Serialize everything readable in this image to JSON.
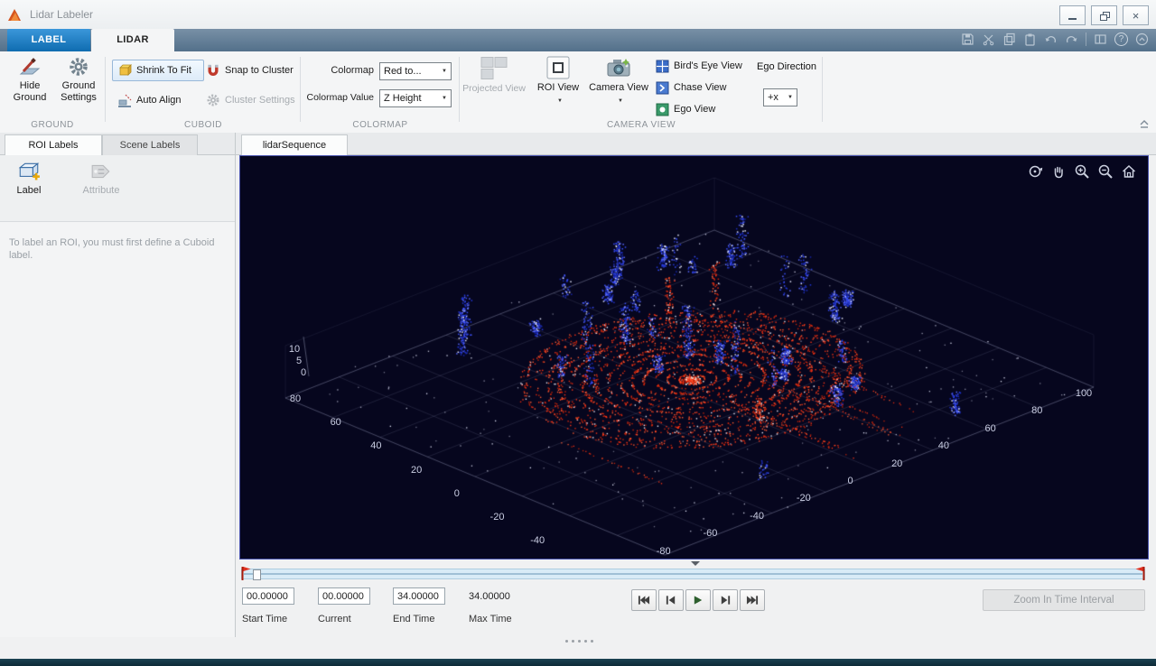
{
  "window": {
    "title": "Lidar Labeler"
  },
  "icons": {
    "close": "×",
    "help": "?",
    "dropdown": "▼"
  },
  "ribbon": {
    "tabs": [
      {
        "label": "LABEL"
      },
      {
        "label": "LIDAR"
      }
    ],
    "sections": {
      "ground": "GROUND",
      "cuboid": "CUBOID",
      "colormap": "COLORMAP",
      "camera_view": "CAMERA VIEW"
    },
    "ground": {
      "hide_ground": "Hide Ground",
      "ground_settings": "Ground Settings"
    },
    "cuboid": {
      "shrink_to_fit": "Shrink To Fit",
      "auto_align": "Auto Align",
      "snap_to_cluster": "Snap to Cluster",
      "cluster_settings": "Cluster Settings"
    },
    "colormap": {
      "colormap_label": "Colormap",
      "colormap_value": "Red to...",
      "value_label": "Colormap Value",
      "value_value": "Z Height"
    },
    "camera": {
      "projected_view": "Projected View",
      "roi_view": "ROI View",
      "camera_view": "Camera View",
      "birds_eye": "Bird's Eye View",
      "chase": "Chase View",
      "ego": "Ego View",
      "ego_direction": "Ego Direction",
      "ego_direction_value": "+x"
    }
  },
  "left_panel": {
    "tabs": [
      {
        "label": "ROI Labels"
      },
      {
        "label": "Scene Labels"
      }
    ],
    "label_button": "Label",
    "attribute_button": "Attribute",
    "hint": "To label an ROI, you must first define a Cuboid label."
  },
  "viewer": {
    "tab": "lidarSequence",
    "axes": {
      "z": [
        "10",
        "5",
        "0"
      ],
      "x": [
        "80",
        "60",
        "40",
        "20",
        "0",
        "-20",
        "-40"
      ],
      "y": [
        "100",
        "80",
        "60",
        "40",
        "20",
        "0",
        "-20",
        "-40",
        "-60",
        "-80"
      ]
    },
    "colors": {
      "background": "#06061e",
      "red": "#e03010",
      "blue": "#2840d8",
      "white": "#e8e8f4"
    }
  },
  "timeline": {
    "start": {
      "value": "00.00000",
      "label": "Start Time"
    },
    "current": {
      "value": "00.00000",
      "label": "Current"
    },
    "end": {
      "value": "34.00000",
      "label": "End Time"
    },
    "max": {
      "value": "34.00000",
      "label": "Max Time"
    },
    "zoom_button": "Zoom In Time Interval"
  }
}
